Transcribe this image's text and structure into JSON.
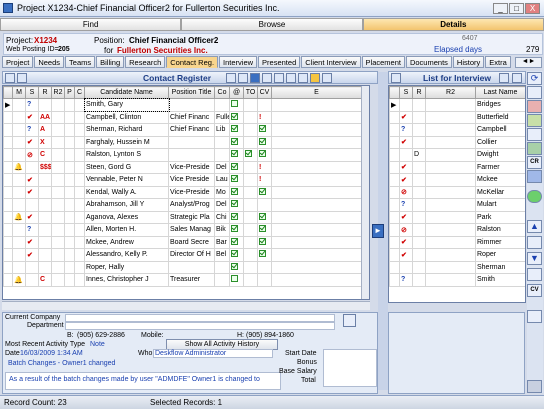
{
  "window": {
    "title": "Project X1234-Chief Financial Officer2 for Fullerton Securities Inc.",
    "min": "_",
    "max": "□",
    "close": "X"
  },
  "nav": {
    "tabs": [
      "Find",
      "Browse",
      "Details"
    ]
  },
  "project": {
    "project_label": "Project:",
    "project_id": "X1234",
    "posting_label": "Web Posting ID=",
    "posting_id": "205",
    "position_label": "Position:",
    "position": "Chief Financial Officer2",
    "for_label": "for",
    "company": "Fullerton Securities Inc.",
    "code": "6407",
    "elapsed_label": "Elapsed days",
    "elapsed": "279"
  },
  "subtabs": [
    "Project",
    "Needs",
    "Teams",
    "Billing",
    "Research",
    "Contact Reg.",
    "Interview",
    "Presented",
    "Client Interview",
    "Placement",
    "Documents",
    "History",
    "Extra"
  ],
  "contact_register": {
    "title": "Contact Register",
    "columns": [
      "M",
      "S",
      "R",
      "R2",
      "P",
      "C",
      "Candidate Name",
      "Position Title",
      "Co",
      "@",
      "TO",
      "CV",
      "E"
    ],
    "rows": [
      {
        "m": "",
        "s": "?",
        "r": "",
        "name": "Smith, Gary",
        "pos": "",
        "co": "",
        "at": false,
        "to": false,
        "cv": false,
        "sel": true
      },
      {
        "m": "",
        "s": "✔",
        "r": "AA",
        "name": "Campbell, Clinton",
        "pos": "Chief Financ",
        "co": "Fullerton",
        "at": true,
        "to": false,
        "cv": "!"
      },
      {
        "m": "",
        "s": "?",
        "r": "A",
        "name": "Sherman, Richard",
        "pos": "Chief Financ",
        "co": "Lib",
        "at": true,
        "to": false,
        "cv": "✔"
      },
      {
        "m": "",
        "s": "✔",
        "r": "X",
        "name": "Farghaly, Hussein M",
        "pos": "",
        "co": "",
        "at": true,
        "to": false,
        "cv": "✔"
      },
      {
        "m": "",
        "s": "⊘",
        "r": "C",
        "name": "Ralston, Lynton S",
        "pos": "",
        "co": "",
        "at": true,
        "to": true,
        "cv": "✔"
      },
      {
        "m": "bell",
        "s": "",
        "r": "$$$",
        "name": "Steen, Gord G",
        "pos": "Vice-Preside",
        "co": "Del",
        "at": true,
        "to": false,
        "cv": "!"
      },
      {
        "m": "",
        "s": "✔",
        "r": "",
        "name": "Vennable, Peter N",
        "pos": "Vice Preside",
        "co": "Lau",
        "at": true,
        "to": false,
        "cv": "!"
      },
      {
        "m": "",
        "s": "✔",
        "r": "",
        "name": "Kendal, Wally A.",
        "pos": "Vice-Preside",
        "co": "Mo",
        "at": true,
        "to": false,
        "cv": "✔"
      },
      {
        "m": "",
        "s": "",
        "r": "",
        "name": "Abrahamson, Jill Y",
        "pos": "Analyst/Prog",
        "co": "Del",
        "at": true,
        "to": false,
        "cv": ""
      },
      {
        "m": "bell",
        "s": "✔",
        "r": "",
        "name": "Aganova, Alexes",
        "pos": "Strategic Pla",
        "co": "Chi",
        "at": true,
        "to": false,
        "cv": "✔"
      },
      {
        "m": "",
        "s": "?",
        "r": "",
        "name": "Allen, Morten H.",
        "pos": "Sales Manag",
        "co": "Bik",
        "at": true,
        "to": false,
        "cv": "✔"
      },
      {
        "m": "",
        "s": "✔",
        "r": "",
        "name": "Mckee, Andrew",
        "pos": "Board Secre",
        "co": "Bar",
        "at": true,
        "to": false,
        "cv": "✔"
      },
      {
        "m": "",
        "s": "✔",
        "r": "",
        "name": "Alessandro, Kelly P.",
        "pos": "Director Of H",
        "co": "Bel",
        "at": true,
        "to": false,
        "cv": "✔"
      },
      {
        "m": "",
        "s": "",
        "r": "",
        "name": "Roper, Hally",
        "pos": "",
        "co": "",
        "at": true,
        "to": false,
        "cv": ""
      },
      {
        "m": "bell",
        "s": "",
        "r": "C",
        "name": "Innes, Christopher J",
        "pos": "Treasurer",
        "co": "",
        "at": false,
        "to": false,
        "cv": ""
      }
    ]
  },
  "interview_list": {
    "title": "List for Interview",
    "columns": [
      "S",
      "R",
      "R2",
      "Last Name"
    ],
    "rows": [
      {
        "s": "",
        "r": "",
        "name": "Bridges"
      },
      {
        "s": "✔",
        "r": "",
        "name": "Butterfield"
      },
      {
        "s": "?",
        "r": "",
        "name": "Campbell"
      },
      {
        "s": "✔",
        "r": "",
        "name": "Collier"
      },
      {
        "s": "",
        "r": "D",
        "name": "Dwight"
      },
      {
        "s": "✔",
        "r": "",
        "name": "Farmer"
      },
      {
        "s": "✔",
        "r": "",
        "name": "Mckee"
      },
      {
        "s": "⊘",
        "r": "",
        "name": "McKellar"
      },
      {
        "s": "?",
        "r": "",
        "name": "Mulart"
      },
      {
        "s": "✔",
        "r": "",
        "name": "Park"
      },
      {
        "s": "⊘",
        "r": "",
        "name": "Ralston"
      },
      {
        "s": "✔",
        "r": "",
        "name": "Rimmer"
      },
      {
        "s": "✔",
        "r": "",
        "name": "Roper"
      },
      {
        "s": "",
        "r": "",
        "name": "Sherman"
      },
      {
        "s": "?",
        "r": "",
        "name": "Smith"
      }
    ]
  },
  "details": {
    "current_company_label": "Current Company",
    "department_label": "Department",
    "b_label": "B:",
    "b_phone": "(905) 629-2886",
    "mobile_label": "Mobile:",
    "h_label": "H:",
    "h_phone": "(905) 894-1860",
    "activity_type_label": "Most Recent Activity Type",
    "activity_type": "Note",
    "history_button": "Show All Activity History",
    "date_label": "Date",
    "date": "16/03/2009 1:34 AM",
    "who_label": "Who",
    "who": "Deskflow Administrator",
    "activity_title": "Batch Changes - Owner1 changed",
    "activity_note": "As a result of the batch changes made by user \"ADMDFE\" Owner1 is changed to",
    "start_date_label": "Start Date",
    "bonus_label": "Bonus",
    "base_salary_label": "Base Salary",
    "total_label": "Total"
  },
  "status": {
    "record_count": "Record Count:  23",
    "selected": "Selected Records:  1"
  }
}
